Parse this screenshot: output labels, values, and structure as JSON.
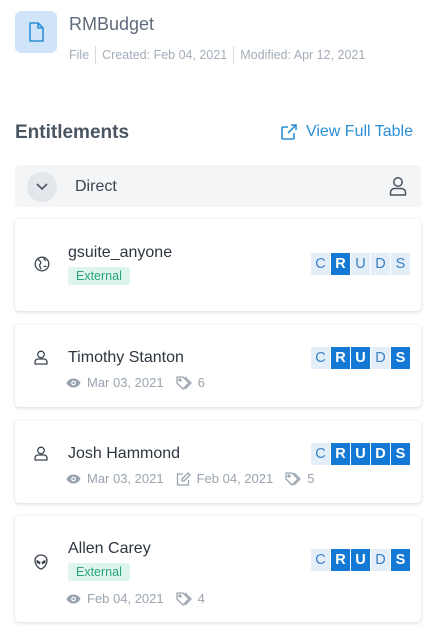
{
  "file": {
    "name": "RMBudget",
    "type": "File",
    "created": "Created: Feb 04, 2021",
    "modified": "Modified: Apr 12, 2021"
  },
  "entitlements": {
    "title": "Entitlements",
    "view_full_label": "View Full Table",
    "group_label": "Direct"
  },
  "cards": [
    {
      "name": "gsuite_anyone",
      "badge": "External",
      "icon": "globe-icon",
      "perms": [
        "C",
        "R",
        "U",
        "D",
        "S"
      ],
      "active": [
        false,
        true,
        false,
        false,
        false
      ]
    },
    {
      "name": "Timothy Stanton",
      "icon": "user-icon",
      "viewed": "Mar 03, 2021",
      "tags": "6",
      "perms": [
        "C",
        "R",
        "U",
        "D",
        "S"
      ],
      "active": [
        false,
        true,
        true,
        false,
        true
      ]
    },
    {
      "name": "Josh Hammond",
      "icon": "user-icon",
      "viewed": "Mar 03, 2021",
      "edited": "Feb 04, 2021",
      "tags": "5",
      "perms": [
        "C",
        "R",
        "U",
        "D",
        "S"
      ],
      "active": [
        false,
        true,
        true,
        true,
        true
      ]
    },
    {
      "name": "Allen Carey",
      "badge": "External",
      "icon": "alien-icon",
      "viewed": "Feb 04, 2021",
      "tags": "4",
      "perms": [
        "C",
        "R",
        "U",
        "D",
        "S"
      ],
      "active": [
        false,
        true,
        true,
        false,
        true
      ]
    }
  ],
  "colors": {
    "accent": "#1479d4",
    "link": "#2b8fd6",
    "badge_bg": "#def5ec",
    "badge_text": "#2aa47a"
  }
}
